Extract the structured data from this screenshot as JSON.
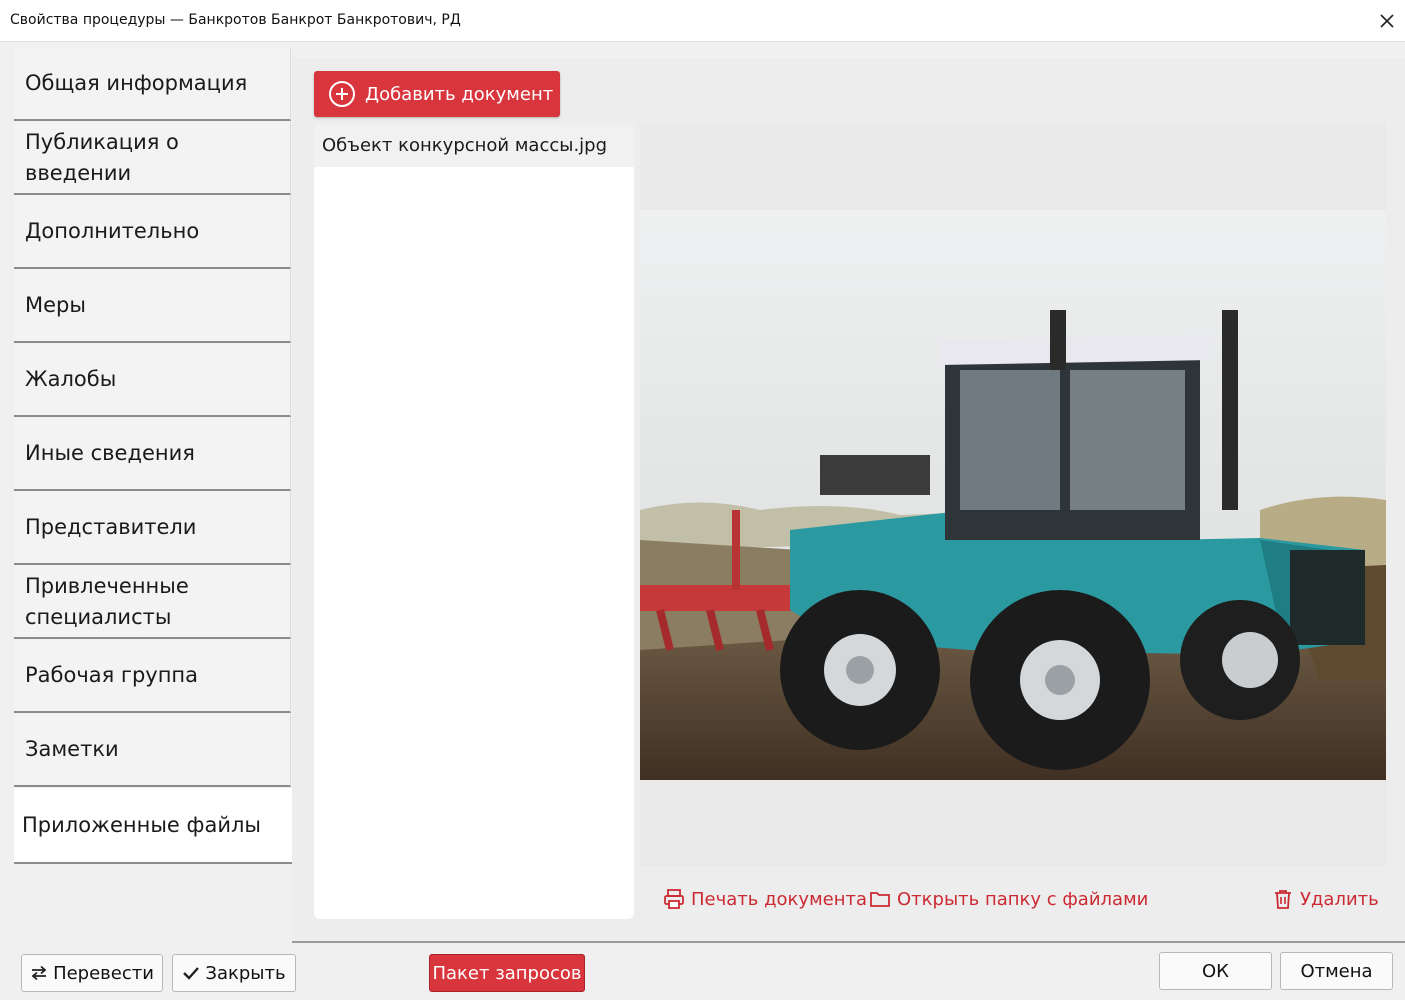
{
  "window": {
    "title": "Свойства процедуры — Банкротов Банкрот Банкротович, РД",
    "close_icon": "close-icon"
  },
  "sidebar": {
    "items": [
      {
        "label": "Общая информация",
        "active": false
      },
      {
        "label": "Публикация о введении",
        "active": false
      },
      {
        "label": "Дополнительно",
        "active": false
      },
      {
        "label": "Меры",
        "active": false
      },
      {
        "label": "Жалобы",
        "active": false
      },
      {
        "label": "Иные сведения",
        "active": false
      },
      {
        "label": "Представители",
        "active": false
      },
      {
        "label": "Привлеченные специалисты",
        "active": false
      },
      {
        "label": "Рабочая группа",
        "active": false
      },
      {
        "label": "Заметки",
        "active": false
      },
      {
        "label": "Приложенные файлы",
        "active": true
      }
    ]
  },
  "main": {
    "add_document_label": "Добавить документ",
    "add_icon": "plus-circle-icon",
    "files": [
      {
        "name": "Объект конкурсной массы.jpg",
        "selected": true
      }
    ],
    "preview": {
      "content": "photo of teal tractor plowing a field"
    },
    "actions": {
      "print_label": "Печать документа",
      "print_icon": "printer-icon",
      "open_folder_label": "Открыть папку с файлами",
      "folder_icon": "folder-icon",
      "delete_label": "Удалить",
      "delete_icon": "trash-icon"
    }
  },
  "footer": {
    "translate_label": "Перевести",
    "translate_icon": "swap-arrows-icon",
    "close_label": "Закрыть",
    "close_icon": "checkmark-icon",
    "requests_label": "Пакет запросов",
    "ok_label": "ОК",
    "cancel_label": "Отмена"
  },
  "colors": {
    "accent": "#d9353d",
    "action_text": "#cc2a33",
    "tractor_body": "#2a9aa0",
    "background": "#f0f0f0"
  }
}
